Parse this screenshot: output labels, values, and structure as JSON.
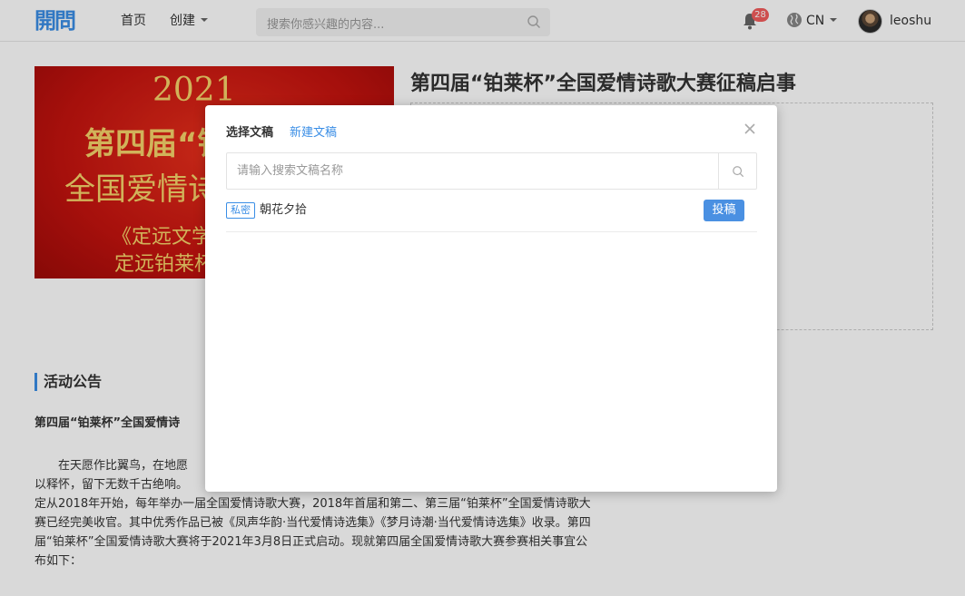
{
  "header": {
    "logo_text": "開問",
    "nav": {
      "home": "首页",
      "create": "创建"
    },
    "search_placeholder": "搜索你感兴趣的内容...",
    "notification_count": "28",
    "language": "CN",
    "username": "leoshu"
  },
  "banner": {
    "year": "2021",
    "line1": "第四届“铂莱杯”",
    "line2": "全国爱情诗歌大赛",
    "line3": "《定远文学》",
    "line4": "定远铂莱杯"
  },
  "contest": {
    "title": "第四届“铂莱杯”全国爱情诗歌大赛征稿启事"
  },
  "announcement": {
    "heading": "活动公告",
    "subheading": "第四届“铂莱杯”全国爱情诗",
    "lines": [
      "　　在天愿作比翼鸟，在地愿",
      "以释怀，留下无数千古绝响。",
      "定从2018年开始，每年举办一届全国爱情诗歌大赛，2018年首届和第二、第三届“铂莱杯”全国爱情诗歌大",
      "赛已经完美收官。其中优秀作品已被《凤声华韵·当代爱情诗选集》《梦月诗潮·当代爱情诗选集》收录。第四",
      "届“铂莱杯”全国爱情诗歌大赛将于2021年3月8日正式启动。现就第四届全国爱情诗歌大赛参赛相关事宜公",
      "布如下："
    ]
  },
  "modal": {
    "tab_select": "选择文稿",
    "tab_new": "新建文稿",
    "search_placeholder": "请输入搜索文稿名称",
    "drafts": [
      {
        "tag": "私密",
        "name": "朝花夕拾",
        "action": "投稿"
      }
    ]
  }
}
